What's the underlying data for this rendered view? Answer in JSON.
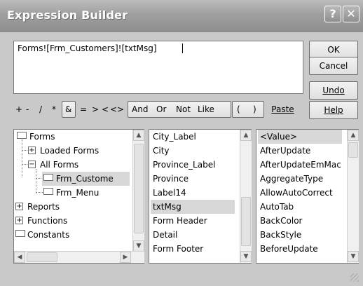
{
  "window": {
    "title": "Expression Builder",
    "help_glyph": "?",
    "close_glyph": "✕"
  },
  "expression": {
    "value": "Forms![Frm_Customers]![txtMsg]"
  },
  "buttons": {
    "ok": "OK",
    "cancel": "Cancel",
    "undo": "Undo",
    "paste": "Paste",
    "help": "Help"
  },
  "operators": [
    "+",
    "-",
    "/",
    "*",
    "&",
    "=",
    ">",
    "<",
    "<>",
    "And",
    "Or",
    "Not",
    "Like",
    "(",
    ")"
  ],
  "tree": {
    "items": [
      {
        "label": "Forms",
        "kind": "root-open"
      },
      {
        "label": "Loaded Forms",
        "kind": "child-collapsed"
      },
      {
        "label": "All Forms",
        "kind": "child-open"
      },
      {
        "label": "Frm_Custome",
        "kind": "leaf-selected"
      },
      {
        "label": "Frm_Menu",
        "kind": "leaf"
      },
      {
        "label": "Reports",
        "kind": "root-collapsed"
      },
      {
        "label": "Functions",
        "kind": "root-collapsed"
      },
      {
        "label": "Constants",
        "kind": "root-folder"
      }
    ]
  },
  "fields": {
    "items": [
      "City_Label",
      "City",
      "Province_Label",
      "Province",
      "Label14",
      "txtMsg",
      "Form Header",
      "Detail",
      "Form Footer"
    ],
    "selected": "txtMsg"
  },
  "properties": {
    "items": [
      "<Value>",
      "AfterUpdate",
      "AfterUpdateEmMac",
      "AggregateType",
      "AllowAutoCorrect",
      "AutoTab",
      "BackColor",
      "BackStyle",
      "BeforeUpdate"
    ],
    "selected": "<Value>"
  },
  "colors": {
    "titlebar": "#9f9f9f",
    "window_bg": "#c9c9c9",
    "selection_bg": "#d8d8d8"
  },
  "icons": {
    "up_arrow": "▲",
    "down_arrow": "▼",
    "left_arrow": "◀",
    "right_arrow": "▶"
  }
}
